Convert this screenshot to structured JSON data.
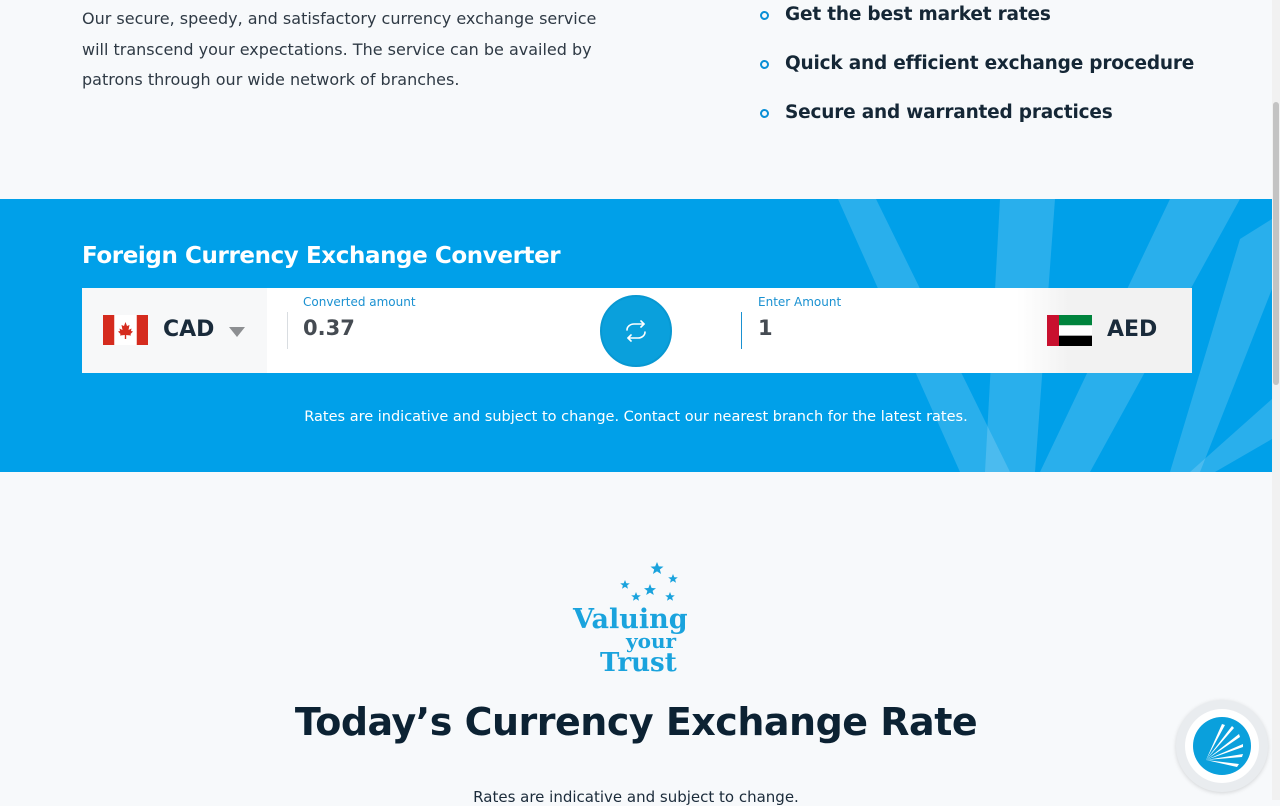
{
  "intro": {
    "paragraph": "Our secure, speedy, and satisfactory currency exchange service will transcend your expectations. The service can be availed by patrons through our wide network of branches."
  },
  "features": [
    {
      "label": "Get the best market rates"
    },
    {
      "label": "Quick and efficient exchange procedure"
    },
    {
      "label": "Secure and warranted practices"
    }
  ],
  "converter": {
    "title": "Foreign Currency Exchange Converter",
    "from_currency": {
      "code": "CAD",
      "flag_icon": "canada-flag-icon"
    },
    "converted_label": "Converted amount",
    "converted_value": "0.37",
    "swap_icon": "swap-icon",
    "enter_label": "Enter Amount",
    "enter_value": "1",
    "to_currency": {
      "code": "AED",
      "flag_icon": "uae-flag-icon"
    },
    "note": "Rates are indicative and subject to change. Contact our nearest branch for the latest rates."
  },
  "trust_logo": {
    "line1": "Valuing",
    "line2": "your",
    "line3": "Trust"
  },
  "rates_section": {
    "heading": "Today’s Currency Exchange Rate",
    "note": "Rates are indicative and subject to change."
  },
  "colors": {
    "accent": "#00a0e9",
    "heading": "#0c2233",
    "bullet": "#0a8fd6"
  }
}
